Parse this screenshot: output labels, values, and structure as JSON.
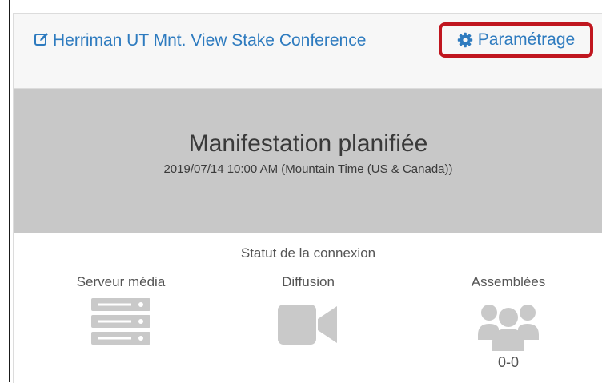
{
  "header": {
    "event_title": "Herriman UT Mnt. View Stake Conference",
    "settings_label": "Paramétrage"
  },
  "status": {
    "title": "Manifestation planifiée",
    "datetime": "2019/07/14 10:00 AM (Mountain Time (US & Canada))"
  },
  "connection": {
    "heading": "Statut de la connexion",
    "media_server_label": "Serveur média",
    "broadcast_label": "Diffusion",
    "assemblies_label": "Assemblées",
    "assemblies_count": "0-0"
  },
  "colors": {
    "link": "#2e7bbf",
    "highlight_border": "#c0161f",
    "banner_bg": "#c8c8c8",
    "icon_grey": "#c9c9c9"
  },
  "icons": {
    "title": "edit-icon",
    "settings": "gear-icon",
    "media_server": "server-icon",
    "broadcast": "video-camera-icon",
    "assemblies": "users-icon"
  }
}
